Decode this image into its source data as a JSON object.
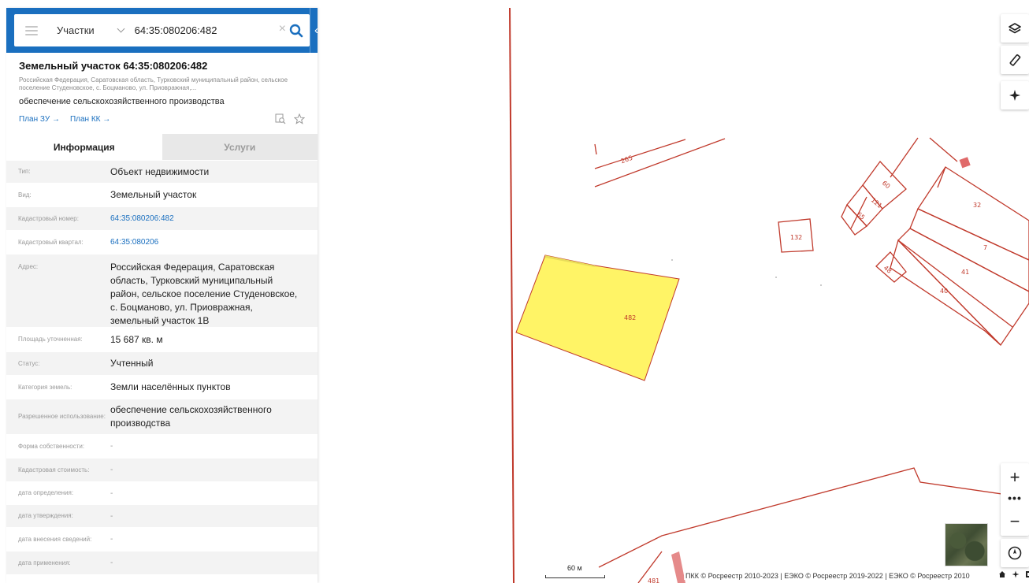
{
  "search": {
    "type_label": "Участки",
    "query": "64:35:080206:482"
  },
  "card": {
    "title": "Земельный участок 64:35:080206:482",
    "address_short": "Российская Федерация, Саратовская область, Турковский муниципальный район, сельское поселение Студеновское, с. Боцманово, ул. Приовражная,...",
    "use": "обеспечение сельскохозяйственного производства",
    "links": [
      "План ЗУ →",
      "План КК →"
    ]
  },
  "tabs": [
    {
      "label": "Информация",
      "active": true
    },
    {
      "label": "Услуги",
      "active": false
    }
  ],
  "info_rows": [
    {
      "label": "Тип:",
      "value": "Объект недвижимости",
      "kind": "text"
    },
    {
      "label": "Вид:",
      "value": "Земельный участок",
      "kind": "text"
    },
    {
      "label": "Кадастровый номер:",
      "value": "64:35:080206:482",
      "kind": "link"
    },
    {
      "label": "Кадастровый квартал:",
      "value": "64:35:080206",
      "kind": "link"
    },
    {
      "label": "Адрес:",
      "value": "Российская Федерация, Саратовская область, Турковский муниципальный район, сельское поселение Студеновское, с. Боцманово, ул. Приовражная, земельный участок 1В",
      "kind": "text"
    },
    {
      "label": "Площадь уточненная:",
      "value": "15 687 кв. м",
      "kind": "text"
    },
    {
      "label": "Статус:",
      "value": "Учтенный",
      "kind": "text"
    },
    {
      "label": "Категория земель:",
      "value": "Земли населённых пунктов",
      "kind": "text"
    },
    {
      "label": "Разрешенное использование:",
      "value": "обеспечение сельскохозяйственного производства",
      "kind": "text"
    },
    {
      "label": "Форма собственности:",
      "value": "-",
      "kind": "dash"
    },
    {
      "label": "Кадастровая стоимость:",
      "value": "-",
      "kind": "dash"
    },
    {
      "label": "дата определения:",
      "value": "-",
      "kind": "dash"
    },
    {
      "label": "дата утверждения:",
      "value": "-",
      "kind": "dash"
    },
    {
      "label": "дата внесения сведений:",
      "value": "-",
      "kind": "dash"
    },
    {
      "label": "дата применения:",
      "value": "-",
      "kind": "dash"
    }
  ],
  "map": {
    "parcel_labels": [
      "482",
      "265",
      "60",
      "121",
      "65",
      "132",
      "32",
      "7",
      "41",
      "40",
      "48",
      "481"
    ],
    "scale_label": "60 м",
    "attribution": "ПКК © Росреестр 2010-2023 | ЕЭКО © Росреестр 2019-2022 | ЕЭКО © Росреестр 2010",
    "zoom_in": "+",
    "zoom_more": "•••",
    "zoom_out": "−"
  },
  "colors": {
    "accent": "#1a6fbf",
    "boundary": "#c0392b",
    "selected_fill": "#fff466"
  },
  "icons": {
    "menu": "menu-icon",
    "search": "search-icon",
    "clear": "clear-icon",
    "layers": "layers-icon",
    "ruler": "ruler-icon",
    "locate": "crosshair-icon",
    "compass": "compass-icon"
  }
}
